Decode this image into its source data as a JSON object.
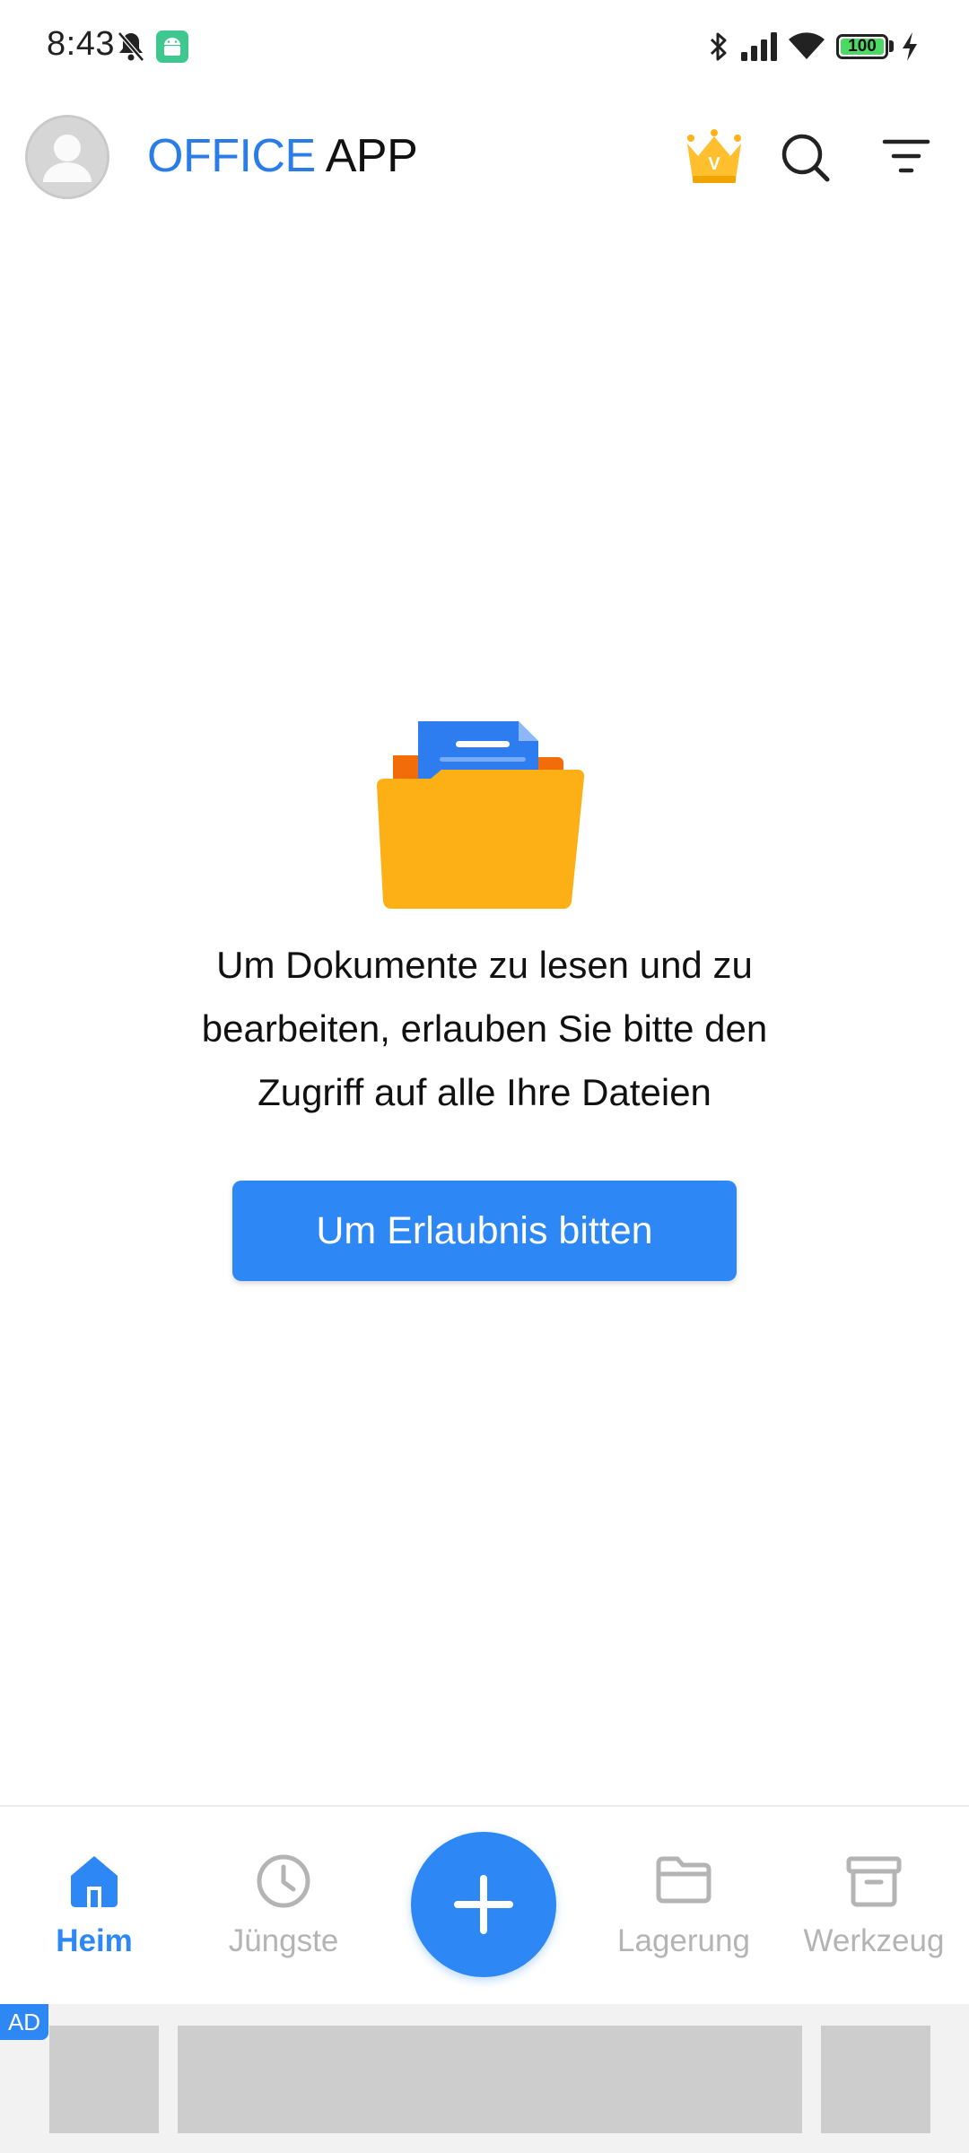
{
  "status_bar": {
    "time": "8:43",
    "battery": "100",
    "icons": [
      "bell-muted-icon",
      "android-icon",
      "bluetooth-icon",
      "signal-icon",
      "wifi-icon",
      "battery-icon",
      "charging-icon"
    ]
  },
  "header": {
    "title_part1": "OFFICE",
    "title_part2": "APP",
    "icons": [
      "avatar-icon",
      "crown-icon",
      "search-icon",
      "filter-icon"
    ],
    "crown_letter": "V",
    "accent_color": "#2a7de9"
  },
  "empty_state": {
    "message_line1": "Um Dokumente zu lesen und zu",
    "message_line2": "bearbeiten, erlauben Sie bitte den",
    "message_line3": "Zugriff auf alle Ihre Dateien",
    "button_label": "Um Erlaubnis bitten",
    "button_color": "#2d87f4",
    "illustration": "folder-documents-icon"
  },
  "bottom_nav": {
    "items": [
      {
        "label": "Heim",
        "icon": "home-icon",
        "active": true
      },
      {
        "label": "Jüngste",
        "icon": "clock-icon",
        "active": false
      },
      {
        "label": "Lagerung",
        "icon": "folder-icon",
        "active": false
      },
      {
        "label": "Werkzeug",
        "icon": "archive-icon",
        "active": false
      }
    ],
    "fab_icon": "plus-icon"
  },
  "ad": {
    "badge": "AD"
  }
}
